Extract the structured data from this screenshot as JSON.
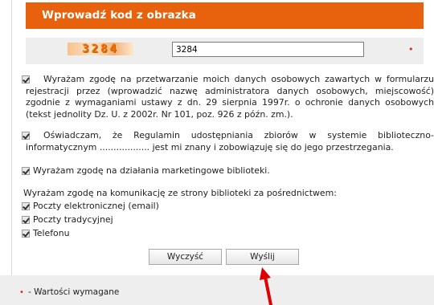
{
  "header": {
    "title": "Wprowadź kod z obrazka"
  },
  "captcha": {
    "image_code": "3284",
    "input_value": "3284",
    "required_marker": "•"
  },
  "consents": {
    "data_processing": "Wyrażam zgodę na przetwarzanie moich danych osobowych zawartych w formularzu rejestracji przez (wprowadzić nazwę administratora danych osobowych, miejscowość) zgodnie z wymaganiami ustawy z dn. 29 sierpnia 1997r. o ochronie danych osobowych (tekst jednolity Dz. U. z 2002r. Nr 101, poz. 926 z późn. zm.).",
    "regulations": "Oświadczam, że Regulamin udostępniania zbiorów w systemie biblioteczno-informatycznym .................. jest mi znany i zobowiązuję się do jego przestrzegania.",
    "marketing": "Wyrażam zgodę na działania marketingowe biblioteki."
  },
  "communication": {
    "heading": "Wyrażam zgodę na komunikację ze strony biblioteki za pośrednictwem:",
    "options": [
      "Poczty elektronicznej (email)",
      "Poczty tradycyjnej",
      "Telefonu"
    ]
  },
  "buttons": {
    "clear": "Wyczyść",
    "submit": "Wyślij"
  },
  "footer": {
    "marker": "•",
    "text": "- Wartości wymagane"
  },
  "colors": {
    "header_bg": "#e8620e",
    "required": "#e02020",
    "arrow": "#e00000"
  }
}
